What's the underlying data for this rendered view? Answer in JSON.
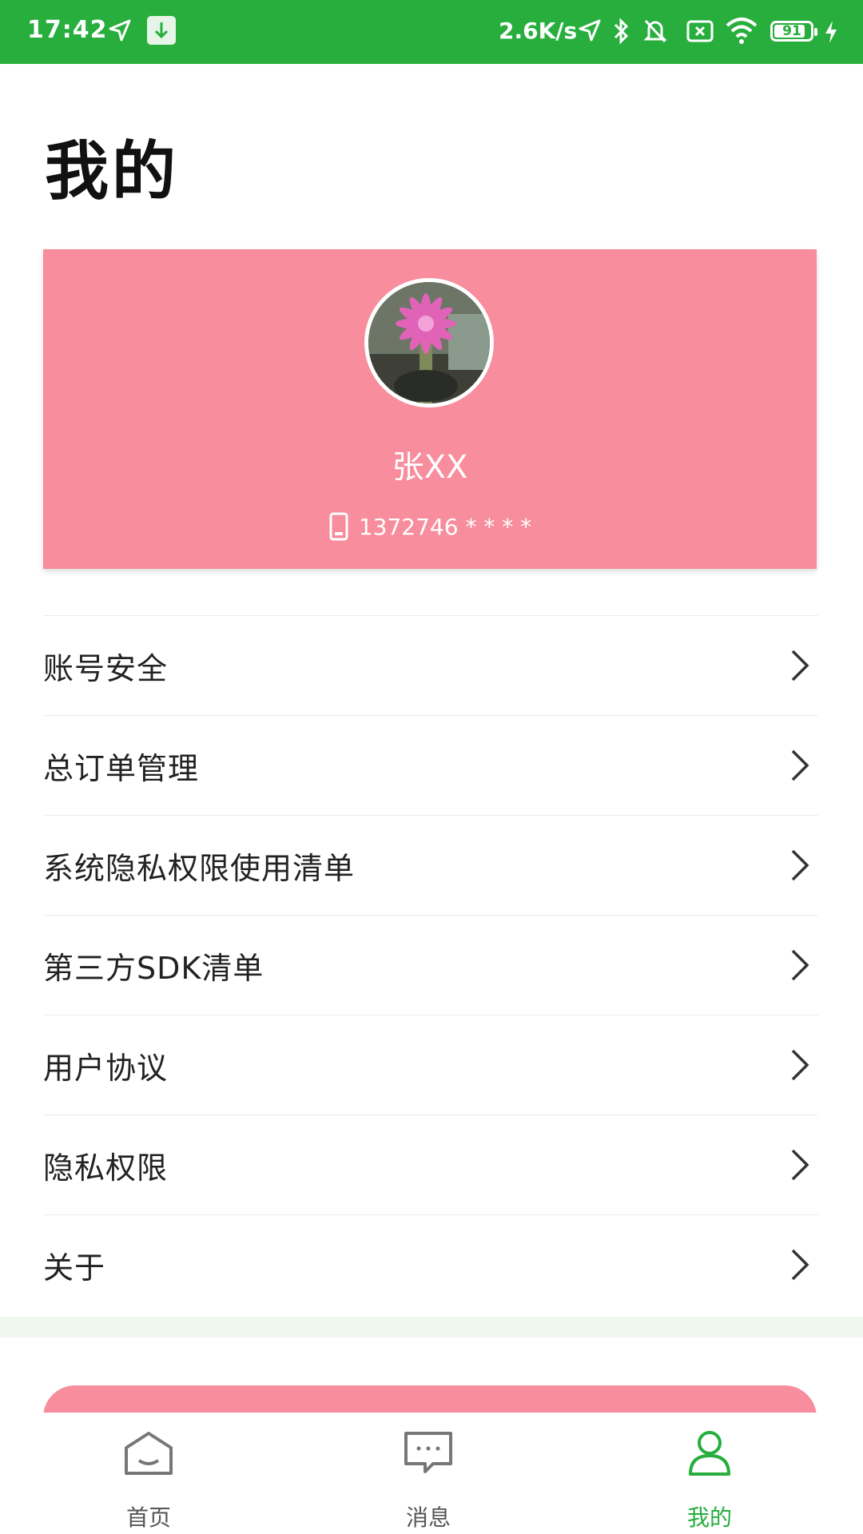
{
  "status_bar": {
    "time": "17:42",
    "network_speed": "2.6K/s",
    "battery": "91",
    "icons": [
      "location-icon",
      "download-icon",
      "location-icon",
      "bluetooth-icon",
      "mute-icon",
      "sim-icon",
      "wifi-icon",
      "battery-icon",
      "charging-icon"
    ]
  },
  "page": {
    "title": "我的"
  },
  "profile": {
    "name": "张XX",
    "phone": "1372746 * * * *",
    "card_color": "#f78d9d"
  },
  "menu": {
    "items": [
      {
        "label": "账号安全"
      },
      {
        "label": "总订单管理"
      },
      {
        "label": "系统隐私权限使用清单"
      },
      {
        "label": "第三方SDK清单"
      },
      {
        "label": "用户协议"
      },
      {
        "label": "隐私权限"
      },
      {
        "label": "关于"
      }
    ]
  },
  "bottom_nav": {
    "items": [
      {
        "label": "首页",
        "icon": "home-icon"
      },
      {
        "label": "消息",
        "icon": "message-icon"
      },
      {
        "label": "我的",
        "icon": "user-icon",
        "active": true
      }
    ],
    "active_color": "#27ae3d"
  }
}
